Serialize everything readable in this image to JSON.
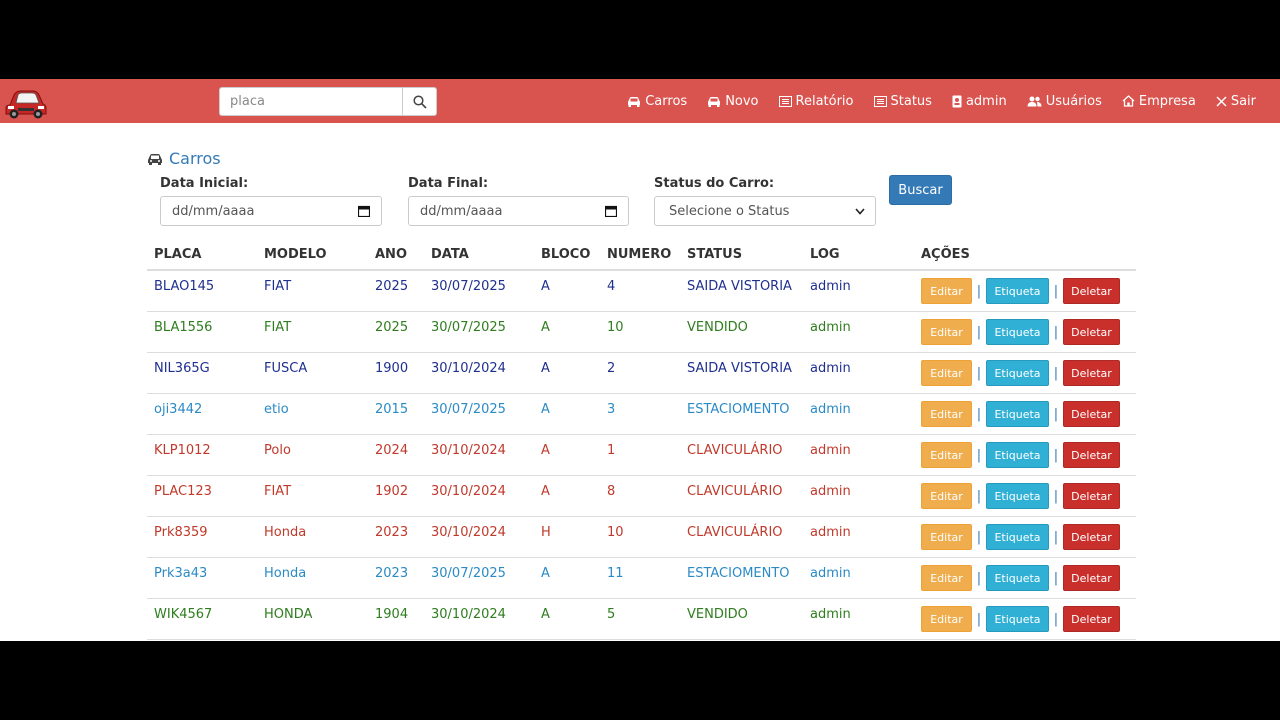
{
  "search": {
    "placeholder": "placa"
  },
  "nav": [
    {
      "label": "Carros",
      "icon": "car-icon"
    },
    {
      "label": "Novo",
      "icon": "car-icon"
    },
    {
      "label": "Relatório",
      "icon": "list-icon"
    },
    {
      "label": "Status",
      "icon": "list-icon"
    },
    {
      "label": "admin",
      "icon": "id-badge-icon"
    },
    {
      "label": "Usuários",
      "icon": "users-icon"
    },
    {
      "label": "Empresa",
      "icon": "home-icon"
    },
    {
      "label": "Sair",
      "icon": "close-icon"
    }
  ],
  "page": {
    "title": "Carros"
  },
  "filters": {
    "start_label": "Data Inicial:",
    "start_placeholder": "dd/mm/aaaa",
    "end_label": "Data Final:",
    "end_placeholder": "dd/mm/aaaa",
    "status_label": "Status do Carro:",
    "status_value": "Selecione o Status",
    "search_button": "Buscar"
  },
  "table": {
    "headers": [
      "PLACA",
      "MODELO",
      "ANO",
      "DATA",
      "BLOCO",
      "NUMERO",
      "STATUS",
      "LOG",
      "AÇÕES"
    ],
    "actions": {
      "edit": "Editar",
      "tag": "Etiqueta",
      "delete": "Deletar",
      "separator": "|"
    },
    "rows": [
      {
        "placa": "BLAO145",
        "modelo": "FIAT",
        "ano": "2025",
        "data": "30/07/2025",
        "bloco": "A",
        "numero": "4",
        "status": "SAIDA VISTORIA",
        "log": "admin",
        "color": "#1f2f8f"
      },
      {
        "placa": "BLA1556",
        "modelo": "FIAT",
        "ano": "2025",
        "data": "30/07/2025",
        "bloco": "A",
        "numero": "10",
        "status": "VENDIDO",
        "log": "admin",
        "color": "#2e7d1e"
      },
      {
        "placa": "NIL365G",
        "modelo": "FUSCA",
        "ano": "1900",
        "data": "30/10/2024",
        "bloco": "A",
        "numero": "2",
        "status": "SAIDA VISTORIA",
        "log": "admin",
        "color": "#1f2f8f"
      },
      {
        "placa": "oji3442",
        "modelo": "etio",
        "ano": "2015",
        "data": "30/07/2025",
        "bloco": "A",
        "numero": "3",
        "status": "ESTACIOMENTO",
        "log": "admin",
        "color": "#2a8ac6"
      },
      {
        "placa": "KLP1012",
        "modelo": "Polo",
        "ano": "2024",
        "data": "30/10/2024",
        "bloco": "A",
        "numero": "1",
        "status": "CLAVICULÁRIO",
        "log": "admin",
        "color": "#c0392b"
      },
      {
        "placa": "PLAC123",
        "modelo": "FIAT",
        "ano": "1902",
        "data": "30/10/2024",
        "bloco": "A",
        "numero": "8",
        "status": "CLAVICULÁRIO",
        "log": "admin",
        "color": "#c0392b"
      },
      {
        "placa": "Prk8359",
        "modelo": "Honda",
        "ano": "2023",
        "data": "30/10/2024",
        "bloco": "H",
        "numero": "10",
        "status": "CLAVICULÁRIO",
        "log": "admin",
        "color": "#c0392b"
      },
      {
        "placa": "Prk3a43",
        "modelo": "Honda",
        "ano": "2023",
        "data": "30/07/2025",
        "bloco": "A",
        "numero": "11",
        "status": "ESTACIOMENTO",
        "log": "admin",
        "color": "#2a8ac6"
      },
      {
        "placa": "WIK4567",
        "modelo": "HONDA",
        "ano": "1904",
        "data": "30/10/2024",
        "bloco": "A",
        "numero": "5",
        "status": "VENDIDO",
        "log": "admin",
        "color": "#2e7d1e"
      }
    ]
  },
  "colors": {
    "navbar": "#d9534f",
    "primary": "#337ab7"
  }
}
